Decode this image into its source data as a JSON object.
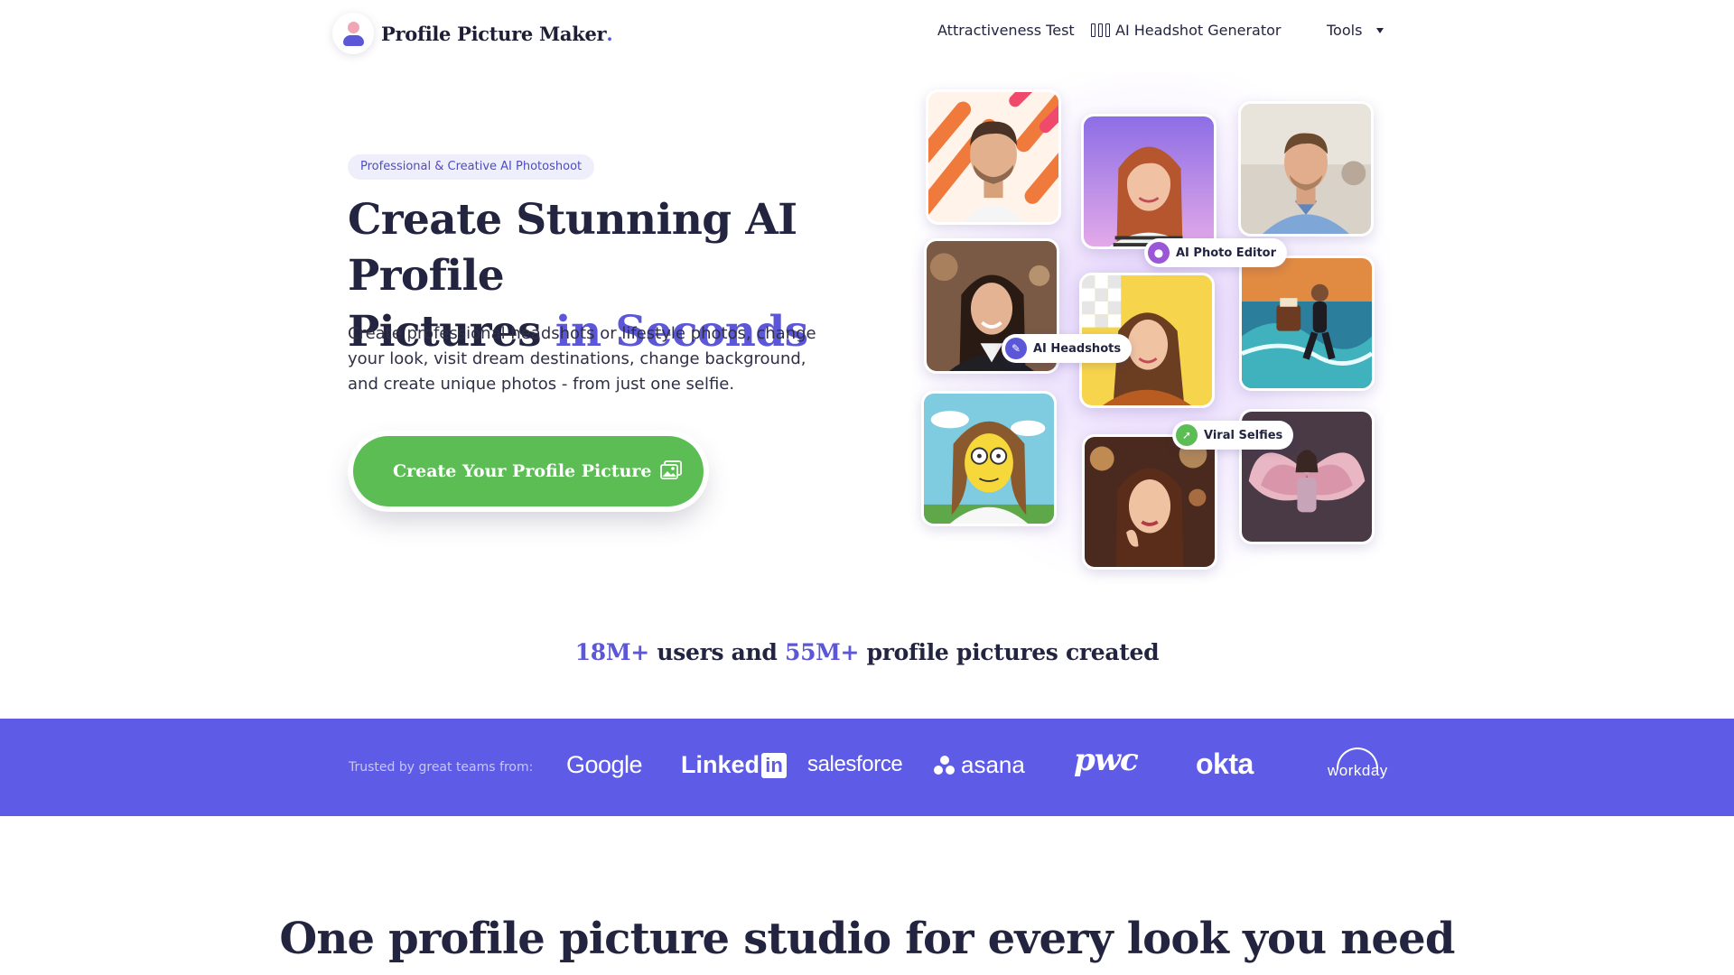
{
  "header": {
    "brand": "Profile Picture Maker",
    "brand_dot": ".",
    "nav": {
      "attractiveness": "Attractiveness Test",
      "headshot": "AI Headshot Generator",
      "tools": "Tools"
    }
  },
  "hero": {
    "tag": "Professional & Creative AI Photoshoot",
    "title_line1": "Create Stunning AI Profile",
    "title_line2_plain": "Pictures",
    "title_line2_accent": "in Seconds",
    "description": "Create professional headshots or lifestyle photos, change your look, visit dream destinations, change background, and create unique photos - from just one selfie.",
    "cta_label": "Create Your Profile Picture"
  },
  "collage": {
    "badges": {
      "photo_editor": "AI Photo Editor",
      "headshots": "AI Headshots",
      "viral": "Viral Selfies"
    }
  },
  "stats": {
    "users_num": "18M+",
    "users_text": "users and",
    "pics_num": "55M+",
    "pics_text": "profile pictures created"
  },
  "trusted": {
    "label": "Trusted by great teams from:",
    "brands": {
      "google": "Google",
      "linkedin": "Linked",
      "linkedin_in": "in",
      "salesforce": "salesforce",
      "asana": "asana",
      "pwc": "pwc",
      "okta": "okta",
      "workday": "workday"
    }
  },
  "section": {
    "title": "One profile picture studio for every look you need"
  },
  "colors": {
    "accent": "#5b57d8",
    "cta": "#5cbd55",
    "band": "#5e5ce6",
    "text": "#232440"
  }
}
